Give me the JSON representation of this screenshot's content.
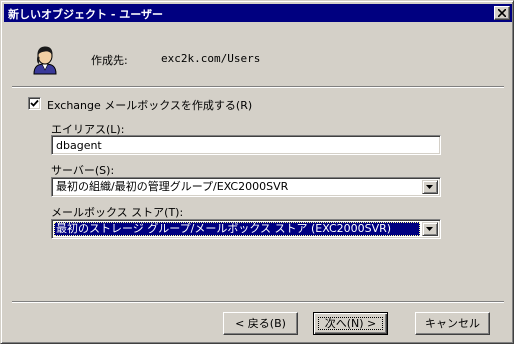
{
  "window": {
    "title": "新しいオブジェクト - ユーザー"
  },
  "header": {
    "create_in_label": "作成先:",
    "create_in_value": "exc2k.com/Users"
  },
  "mailbox_checkbox": {
    "checked": true,
    "label": "Exchange メールボックスを作成する(R)"
  },
  "alias": {
    "label": "エイリアス(L):",
    "value": "dbagent"
  },
  "server": {
    "label": "サーバー(S):",
    "value": "最初の組織/最初の管理グループ/EXC2000SVR"
  },
  "store": {
    "label": "メールボックス ストア(T):",
    "value": "最初のストレージ グループ/メールボックス ストア (EXC2000SVR)"
  },
  "buttons": {
    "back": "< 戻る(B)",
    "next": "次へ(N) >",
    "cancel": "キャンセル"
  },
  "colors": {
    "face": "#d4d0c8",
    "titlebar": "#000080",
    "selection": "#000080"
  }
}
